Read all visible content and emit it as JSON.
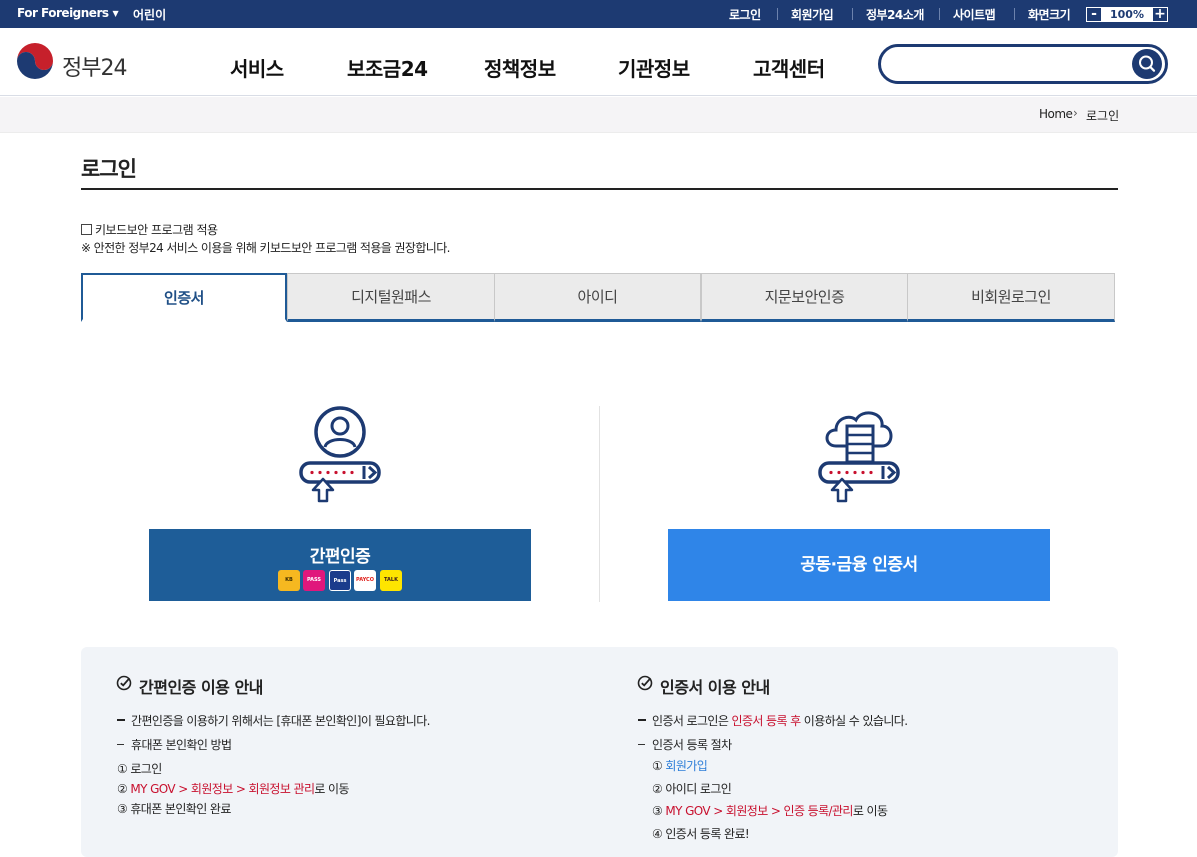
{
  "topbar": {
    "foreigners": "For Foreigners",
    "kids": "어린이",
    "links": [
      "로그인",
      "회원가입",
      "정부24소개",
      "사이트맵",
      "화면크기"
    ],
    "zoom_minus": "-",
    "zoom_value": "100%",
    "zoom_plus": "+"
  },
  "header": {
    "logo_text": "정부24",
    "nav": [
      "서비스",
      "보조금24",
      "정책정보",
      "기관정보",
      "고객센터"
    ],
    "search_placeholder": ""
  },
  "breadcrumb": {
    "home": "Home",
    "current": "로그인"
  },
  "page": {
    "title": "로그인",
    "keyboard_security_label": "키보드보안 프로그램 적용",
    "keyboard_security_note": "※ 안전한 정부24 서비스 이용을 위해 키보드보안 프로그램 적용을 권장합니다."
  },
  "tabs": [
    "인증서",
    "디지털원패스",
    "아이디",
    "지문보안인증",
    "비회원로그인"
  ],
  "login": {
    "easy_auth_label": "간편인증",
    "easy_auth_providers": [
      "KB",
      "PASS",
      "Pass",
      "PAYCO",
      "TALK"
    ],
    "cert_label": "공동·금융 인증서"
  },
  "guide": {
    "left": {
      "title": "간편인증 이용 안내",
      "line1": "간편인증을 이용하기 위해서는 [휴대폰 본인확인]이 필요합니다.",
      "line2": "휴대폰 본인확인 방법",
      "step1": "① 로그인",
      "step2_prefix": "② ",
      "step2_path": "MY GOV > 회원정보 > 회원정보 관리",
      "step2_suffix": "로 이동",
      "step3": "③ 휴대폰 본인확인 완료"
    },
    "right": {
      "title": "인증서 이용 안내",
      "line1_a": "인증서 로그인은 ",
      "line1_red": "인증서 등록 후",
      "line1_b": " 이용하실 수 있습니다.",
      "line2": "인증서 등록 절차",
      "step1_prefix": "① ",
      "step1_link": "회원가입",
      "step2": "② 아이디 로그인",
      "step3_prefix": "③ ",
      "step3_path": "MY GOV > 회원정보 > 인증 등록/관리",
      "step3_suffix": "로 이동",
      "step4": "④ 인증서 등록 완료!"
    }
  },
  "colors": {
    "navy": "#1d3a72",
    "tab_blue": "#1f5a96",
    "easy_btn": "#1e5d98",
    "cert_btn": "#2f85e8",
    "emphasis_red": "#c8102e"
  }
}
